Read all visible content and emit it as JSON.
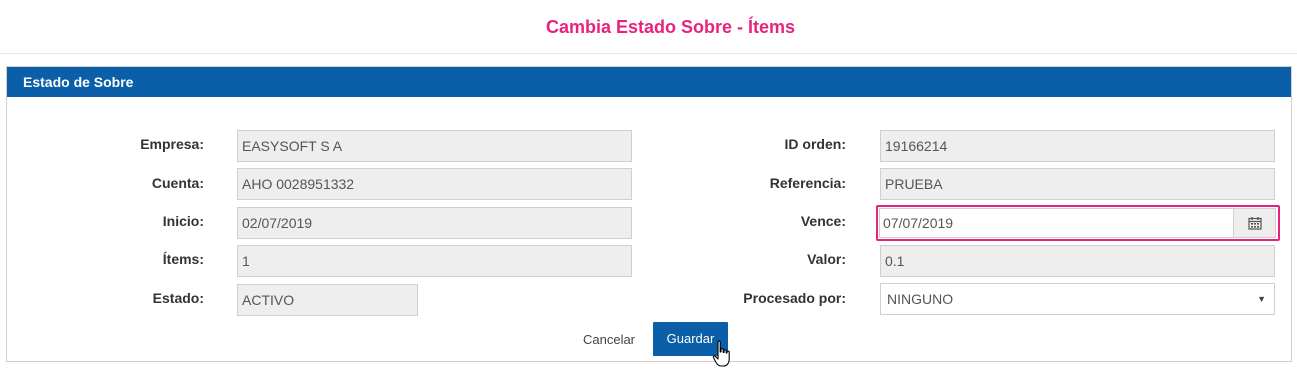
{
  "page": {
    "title": "Cambia Estado Sobre - Ítems"
  },
  "panel": {
    "title": "Estado de Sobre"
  },
  "left_fields": [
    {
      "label": "Empresa:",
      "value": "EASYSOFT S A"
    },
    {
      "label": "Cuenta:",
      "value": "AHO 0028951332"
    },
    {
      "label": "Inicio:",
      "value": "02/07/2019"
    },
    {
      "label": "Ítems:",
      "value": "1"
    },
    {
      "label": "Estado:",
      "value": "ACTIVO"
    }
  ],
  "right_fields": [
    {
      "label": "ID orden:",
      "value": "19166214"
    },
    {
      "label": "Referencia:",
      "value": "PRUEBA"
    },
    {
      "label": "Vence:",
      "value": "07/07/2019",
      "icon": "calendar-icon"
    },
    {
      "label": "Valor:",
      "value": "0.1"
    },
    {
      "label": "Procesado por:",
      "value": "NINGUNO",
      "icon": "caret-down-icon"
    }
  ],
  "buttons": {
    "cancel": "Cancelar",
    "save": "Guardar"
  },
  "colors": {
    "accent": "#e8237f",
    "header": "#0b5ea8",
    "readonly_bg": "#eeeeee"
  }
}
